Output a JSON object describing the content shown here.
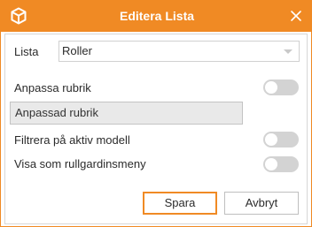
{
  "window": {
    "title": "Editera Lista",
    "accent_color": "#f08a24",
    "logo_icon": "cube-icon",
    "close_icon": "close-icon"
  },
  "form": {
    "list_label": "Lista",
    "list_value": "Roller",
    "custom_header_label": "Anpassa rubrik",
    "custom_header_toggle_on": false,
    "custom_header_value": "Anpassad rubrik",
    "filter_label": "Filtrera på aktiv modell",
    "filter_toggle_on": false,
    "dropdown_label": "Visa som rullgardinsmeny",
    "dropdown_toggle_on": false
  },
  "buttons": {
    "save": "Spara",
    "cancel": "Avbryt"
  }
}
